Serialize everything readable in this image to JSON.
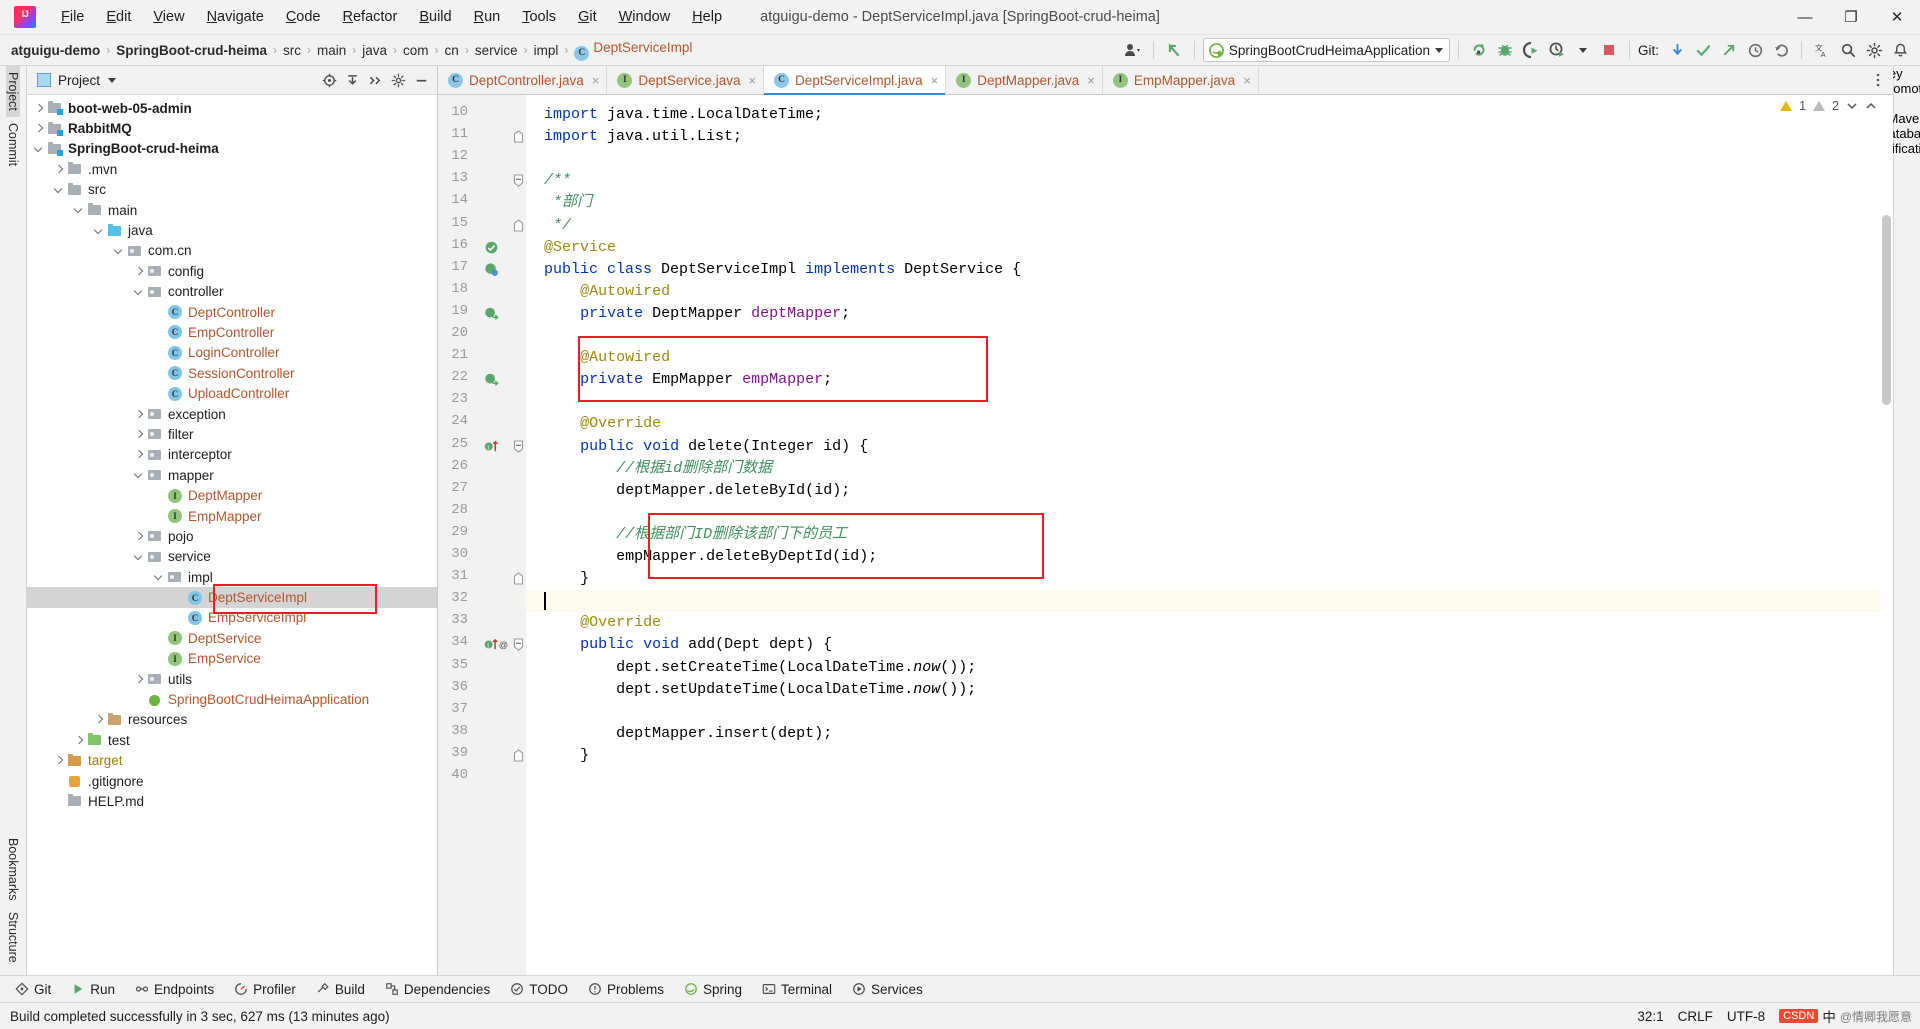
{
  "window": {
    "title": "atguigu-demo - DeptServiceImpl.java [SpringBoot-crud-heima]",
    "minimize": "—",
    "maximize": "❐",
    "close": "✕"
  },
  "menubar": {
    "items": [
      {
        "label": "File"
      },
      {
        "label": "Edit"
      },
      {
        "label": "View"
      },
      {
        "label": "Navigate"
      },
      {
        "label": "Code"
      },
      {
        "label": "Refactor"
      },
      {
        "label": "Build"
      },
      {
        "label": "Run"
      },
      {
        "label": "Tools"
      },
      {
        "label": "Git"
      },
      {
        "label": "Window"
      },
      {
        "label": "Help"
      }
    ]
  },
  "breadcrumb": {
    "items": [
      {
        "label": "atguigu-demo",
        "style": "bold"
      },
      {
        "label": "SpringBoot-crud-heima",
        "style": "bold"
      },
      {
        "label": "src",
        "style": "plain"
      },
      {
        "label": "main",
        "style": "plain"
      },
      {
        "label": "java",
        "style": "plain"
      },
      {
        "label": "com",
        "style": "plain"
      },
      {
        "label": "cn",
        "style": "plain"
      },
      {
        "label": "service",
        "style": "plain"
      },
      {
        "label": "impl",
        "style": "plain"
      },
      {
        "label": "DeptServiceImpl",
        "style": "class"
      }
    ],
    "separator": "›"
  },
  "toolbar": {
    "run_configuration": "SpringBootCrudHeimaApplication",
    "git_label": "Git:",
    "icons": [
      "user-avatar-icon",
      "undo-icon",
      "rerun-icon",
      "debug-icon",
      "run-with-coverage-icon",
      "profiler-icon",
      "stop-icon",
      "git-update-icon",
      "git-commit-icon",
      "git-push-icon",
      "history-icon",
      "rollback-icon",
      "translate-icon",
      "search-icon",
      "settings-icon",
      "notifications-icon"
    ],
    "accent_green": "#59a869",
    "accent_red": "#db5860",
    "accent_blue": "#3d87d8"
  },
  "left_rail": {
    "top": [
      "Project",
      "Commit"
    ],
    "bottom": [
      "Bookmarks",
      "Structure"
    ]
  },
  "right_rail": {
    "items": [
      "Key Promoter X",
      "Maven",
      "Database",
      "Notifications"
    ]
  },
  "project_panel": {
    "title": "Project",
    "header_icons": [
      "locate-icon",
      "collapse-all-icon",
      "expand-icon",
      "settings-icon",
      "hide-icon"
    ],
    "tree": [
      {
        "label": "boot-web-05-admin",
        "depth": 1,
        "arrow": "right",
        "icon": "mod",
        "style": "bold"
      },
      {
        "label": "RabbitMQ",
        "depth": 1,
        "arrow": "right",
        "icon": "mod",
        "style": "bold"
      },
      {
        "label": "SpringBoot-crud-heima",
        "depth": 1,
        "arrow": "down",
        "icon": "mod",
        "style": "bold"
      },
      {
        "label": ".mvn",
        "depth": 2,
        "arrow": "right",
        "icon": "fo",
        "style": "plain"
      },
      {
        "label": "src",
        "depth": 2,
        "arrow": "down",
        "icon": "fo",
        "style": "plain"
      },
      {
        "label": "main",
        "depth": 3,
        "arrow": "down",
        "icon": "fo",
        "style": "plain"
      },
      {
        "label": "java",
        "depth": 4,
        "arrow": "down",
        "icon": "src",
        "style": "plain"
      },
      {
        "label": "com.cn",
        "depth": 5,
        "arrow": "down",
        "icon": "pkg",
        "style": "plain"
      },
      {
        "label": "config",
        "depth": 6,
        "arrow": "right",
        "icon": "pkg",
        "style": "plain"
      },
      {
        "label": "controller",
        "depth": 6,
        "arrow": "down",
        "icon": "pkg",
        "style": "plain"
      },
      {
        "label": "DeptController",
        "depth": 7,
        "arrow": "none",
        "icon": "jcls",
        "style": "orange"
      },
      {
        "label": "EmpController",
        "depth": 7,
        "arrow": "none",
        "icon": "jcls",
        "style": "orange"
      },
      {
        "label": "LoginController",
        "depth": 7,
        "arrow": "none",
        "icon": "jcls",
        "style": "orange"
      },
      {
        "label": "SessionController",
        "depth": 7,
        "arrow": "none",
        "icon": "jcls",
        "style": "orange"
      },
      {
        "label": "UploadController",
        "depth": 7,
        "arrow": "none",
        "icon": "jcls",
        "style": "orange"
      },
      {
        "label": "exception",
        "depth": 6,
        "arrow": "right",
        "icon": "pkg",
        "style": "plain"
      },
      {
        "label": "filter",
        "depth": 6,
        "arrow": "right",
        "icon": "pkg",
        "style": "plain"
      },
      {
        "label": "interceptor",
        "depth": 6,
        "arrow": "right",
        "icon": "pkg",
        "style": "plain"
      },
      {
        "label": "mapper",
        "depth": 6,
        "arrow": "down",
        "icon": "pkg",
        "style": "plain"
      },
      {
        "label": "DeptMapper",
        "depth": 7,
        "arrow": "none",
        "icon": "jint",
        "style": "orange"
      },
      {
        "label": "EmpMapper",
        "depth": 7,
        "arrow": "none",
        "icon": "jint",
        "style": "orange"
      },
      {
        "label": "pojo",
        "depth": 6,
        "arrow": "right",
        "icon": "pkg",
        "style": "plain"
      },
      {
        "label": "service",
        "depth": 6,
        "arrow": "down",
        "icon": "pkg",
        "style": "plain"
      },
      {
        "label": "impl",
        "depth": 7,
        "arrow": "down",
        "icon": "pkg",
        "style": "plain"
      },
      {
        "label": "DeptServiceImpl",
        "depth": 8,
        "arrow": "none",
        "icon": "jcls",
        "style": "orange",
        "selected": true
      },
      {
        "label": "EmpServiceImpl",
        "depth": 8,
        "arrow": "none",
        "icon": "jcls",
        "style": "orange"
      },
      {
        "label": "DeptService",
        "depth": 7,
        "arrow": "none",
        "icon": "jint",
        "style": "orange"
      },
      {
        "label": "EmpService",
        "depth": 7,
        "arrow": "none",
        "icon": "jint",
        "style": "orange"
      },
      {
        "label": "utils",
        "depth": 6,
        "arrow": "right",
        "icon": "pkg",
        "style": "plain"
      },
      {
        "label": "SpringBootCrudHeimaApplication",
        "depth": 6,
        "arrow": "none",
        "icon": "spring",
        "style": "orange"
      },
      {
        "label": "resources",
        "depth": 4,
        "arrow": "right",
        "icon": "res",
        "style": "plain"
      },
      {
        "label": "test",
        "depth": 3,
        "arrow": "right",
        "icon": "test",
        "style": "plain"
      },
      {
        "label": "target",
        "depth": 2,
        "arrow": "right",
        "icon": "excl",
        "style": "yellow"
      },
      {
        "label": ".gitignore",
        "depth": 2,
        "arrow": "none",
        "icon": "git",
        "style": "plain"
      },
      {
        "label": "HELP.md",
        "depth": 2,
        "arrow": "none",
        "icon": "fo",
        "style": "plain"
      }
    ]
  },
  "editor": {
    "tabs": [
      {
        "label": "DeptController.java",
        "icon": "class-icon",
        "active": false
      },
      {
        "label": "DeptService.java",
        "icon": "interface-icon",
        "active": false
      },
      {
        "label": "DeptServiceImpl.java",
        "icon": "class-icon",
        "active": true
      },
      {
        "label": "DeptMapper.java",
        "icon": "interface-icon",
        "active": false
      },
      {
        "label": "EmpMapper.java",
        "icon": "interface-icon",
        "active": false
      }
    ],
    "inspection": {
      "warnings": "1",
      "weak_warnings": "2"
    },
    "caret_position": "32:1",
    "lines": [
      {
        "n": 10,
        "indent": 0,
        "tokens": [
          {
            "t": "import",
            "c": "kw"
          },
          {
            "t": " java.time.LocalDateTime;",
            "c": "typ"
          }
        ]
      },
      {
        "n": 11,
        "indent": 0,
        "fold": "end",
        "tokens": [
          {
            "t": "import",
            "c": "kw"
          },
          {
            "t": " java.util.List;",
            "c": "typ"
          }
        ]
      },
      {
        "n": 12,
        "indent": 0,
        "tokens": []
      },
      {
        "n": 13,
        "indent": 0,
        "fold": "start",
        "tokens": [
          {
            "t": "/**",
            "c": "cmt"
          }
        ]
      },
      {
        "n": 14,
        "indent": 0,
        "tokens": [
          {
            "t": " *部门",
            "c": "cmt"
          }
        ]
      },
      {
        "n": 15,
        "indent": 0,
        "fold": "end",
        "tokens": [
          {
            "t": " */",
            "c": "cmt"
          }
        ]
      },
      {
        "n": 16,
        "indent": 0,
        "gutter": "spring-bean",
        "tokens": [
          {
            "t": "@Service",
            "c": "ann"
          }
        ]
      },
      {
        "n": 17,
        "indent": 0,
        "gutter": "spring-impl",
        "tokens": [
          {
            "t": "public",
            "c": "kw"
          },
          {
            "t": " ",
            "c": "typ"
          },
          {
            "t": "class",
            "c": "kw"
          },
          {
            "t": " DeptServiceImpl ",
            "c": "typ"
          },
          {
            "t": "implements",
            "c": "kw"
          },
          {
            "t": " DeptService {",
            "c": "typ"
          }
        ]
      },
      {
        "n": 18,
        "indent": 1,
        "tokens": [
          {
            "t": "@Autowired",
            "c": "ann"
          }
        ]
      },
      {
        "n": 19,
        "indent": 1,
        "gutter": "bean-arrow",
        "tokens": [
          {
            "t": "private",
            "c": "kw"
          },
          {
            "t": " DeptMapper ",
            "c": "typ"
          },
          {
            "t": "deptMapper",
            "c": "fld"
          },
          {
            "t": ";",
            "c": "typ"
          }
        ]
      },
      {
        "n": 20,
        "indent": 0,
        "tokens": []
      },
      {
        "n": 21,
        "indent": 1,
        "tokens": [
          {
            "t": "@Autowired",
            "c": "ann"
          }
        ]
      },
      {
        "n": 22,
        "indent": 1,
        "gutter": "bean-arrow",
        "tokens": [
          {
            "t": "private",
            "c": "kw"
          },
          {
            "t": " EmpMapper ",
            "c": "typ"
          },
          {
            "t": "empMapper",
            "c": "fld"
          },
          {
            "t": ";",
            "c": "typ"
          }
        ]
      },
      {
        "n": 23,
        "indent": 0,
        "tokens": []
      },
      {
        "n": 24,
        "indent": 1,
        "tokens": [
          {
            "t": "@Override",
            "c": "ann"
          }
        ]
      },
      {
        "n": 25,
        "indent": 1,
        "gutter": "override-up",
        "fold": "start",
        "tokens": [
          {
            "t": "public",
            "c": "kw"
          },
          {
            "t": " ",
            "c": "typ"
          },
          {
            "t": "void",
            "c": "kw"
          },
          {
            "t": " delete(Integer id) {",
            "c": "typ"
          }
        ]
      },
      {
        "n": 26,
        "indent": 2,
        "tokens": [
          {
            "t": "//根据id删除部门数据",
            "c": "cmt"
          }
        ]
      },
      {
        "n": 27,
        "indent": 2,
        "tokens": [
          {
            "t": "deptMapper.deleteById(id);",
            "c": "typ"
          }
        ]
      },
      {
        "n": 28,
        "indent": 0,
        "tokens": []
      },
      {
        "n": 29,
        "indent": 2,
        "tokens": [
          {
            "t": "//根据部门ID删除该部门下的员工",
            "c": "cmt"
          }
        ]
      },
      {
        "n": 30,
        "indent": 2,
        "tokens": [
          {
            "t": "empMapper.deleteByDeptId(id);",
            "c": "typ"
          }
        ]
      },
      {
        "n": 31,
        "indent": 1,
        "fold": "end",
        "tokens": [
          {
            "t": "}",
            "c": "typ"
          }
        ]
      },
      {
        "n": 32,
        "indent": 0,
        "highlight": true,
        "caret": true,
        "tokens": []
      },
      {
        "n": 33,
        "indent": 1,
        "tokens": [
          {
            "t": "@Override",
            "c": "ann"
          }
        ]
      },
      {
        "n": 34,
        "indent": 1,
        "gutter": "override-at",
        "fold": "start",
        "tokens": [
          {
            "t": "public",
            "c": "kw"
          },
          {
            "t": " ",
            "c": "typ"
          },
          {
            "t": "void",
            "c": "kw"
          },
          {
            "t": " add(Dept dept) {",
            "c": "typ"
          }
        ]
      },
      {
        "n": 35,
        "indent": 2,
        "tokens": [
          {
            "t": "dept.setCreateTime(LocalDateTime.",
            "c": "typ"
          },
          {
            "t": "now",
            "c": "ital"
          },
          {
            "t": "());",
            "c": "typ"
          }
        ]
      },
      {
        "n": 36,
        "indent": 2,
        "tokens": [
          {
            "t": "dept.setUpdateTime(LocalDateTime.",
            "c": "typ"
          },
          {
            "t": "now",
            "c": "ital"
          },
          {
            "t": "());",
            "c": "typ"
          }
        ]
      },
      {
        "n": 37,
        "indent": 0,
        "tokens": []
      },
      {
        "n": 38,
        "indent": 2,
        "tokens": [
          {
            "t": "deptMapper.insert(dept);",
            "c": "typ"
          }
        ]
      },
      {
        "n": 39,
        "indent": 1,
        "fold": "end",
        "tokens": [
          {
            "t": "}",
            "c": "typ"
          }
        ]
      },
      {
        "n": 40,
        "indent": 0,
        "tokens": []
      }
    ]
  },
  "bottom_tools": [
    {
      "label": "Git",
      "icon": "git-icon"
    },
    {
      "label": "Run",
      "icon": "run-icon"
    },
    {
      "label": "Endpoints",
      "icon": "endpoints-icon"
    },
    {
      "label": "Profiler",
      "icon": "profiler-icon"
    },
    {
      "label": "Build",
      "icon": "build-icon"
    },
    {
      "label": "Dependencies",
      "icon": "dependencies-icon"
    },
    {
      "label": "TODO",
      "icon": "todo-icon"
    },
    {
      "label": "Problems",
      "icon": "problems-icon"
    },
    {
      "label": "Spring",
      "icon": "spring-icon"
    },
    {
      "label": "Terminal",
      "icon": "terminal-icon"
    },
    {
      "label": "Services",
      "icon": "services-icon"
    }
  ],
  "statusbar": {
    "message": "Build completed successfully in 3 sec, 627 ms (13 minutes ago)",
    "caret": "32:1",
    "line_separator": "CRLF",
    "encoding": "UTF-8",
    "ime": "中",
    "watermark_badge": "CSDN",
    "watermark_text": "@情卿我愿意"
  }
}
